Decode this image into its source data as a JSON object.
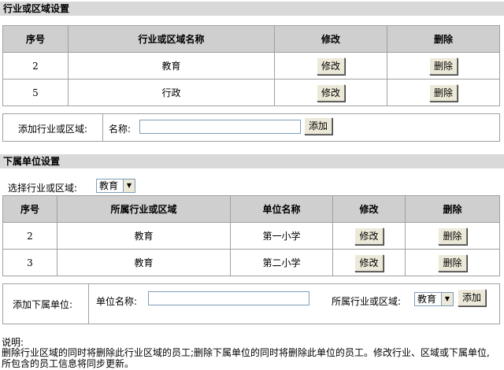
{
  "industry": {
    "title": "行业或区域设置",
    "headers": [
      "序号",
      "行业或区域名称",
      "修改",
      "删除"
    ],
    "rows": [
      {
        "id": "2",
        "name": "教育"
      },
      {
        "id": "5",
        "name": "行政"
      }
    ],
    "edit_label": "修改",
    "delete_label": "删除",
    "add_label": "添加行业或区域:",
    "name_label": "名称:",
    "name_value": "",
    "add_button": "添加"
  },
  "units": {
    "title": "下属单位设置",
    "select_label": "选择行业或区域:",
    "select_value": "教育",
    "headers": [
      "序号",
      "所属行业或区域",
      "单位名称",
      "修改",
      "删除"
    ],
    "rows": [
      {
        "id": "2",
        "industry": "教育",
        "name": "第一小学"
      },
      {
        "id": "3",
        "industry": "教育",
        "name": "第二小学"
      }
    ],
    "edit_label": "修改",
    "delete_label": "删除",
    "add_label": "添加下属单位:",
    "unit_name_label": "单位名称:",
    "unit_name_value": "",
    "belong_label": "所属行业或区域:",
    "belong_value": "教育",
    "add_button": "添加"
  },
  "note": {
    "title": "说明:",
    "text": "删除行业区域的同时将删除此行业区域的员工;删除下属单位的同时将删除此单位的员工。修改行业、区域或下属单位,所包含的员工信息将同步更新。"
  }
}
